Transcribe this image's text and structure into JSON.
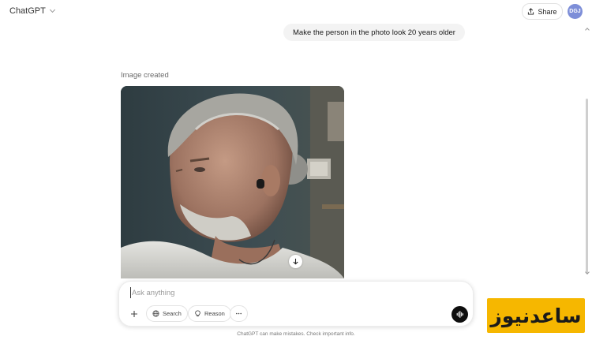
{
  "header": {
    "model_name": "ChatGPT",
    "share_label": "Share",
    "avatar_initials": "DGJ",
    "avatar_color": "#7d8ed8"
  },
  "conversation": {
    "user_message": "Make the person in the photo look 20 years older",
    "image_caption": "Image created"
  },
  "composer": {
    "placeholder": "Ask anything",
    "tools": [
      {
        "label": "Search",
        "icon": "globe-icon"
      },
      {
        "label": "Reason",
        "icon": "lightbulb-icon"
      }
    ],
    "more_icon": "ellipsis-icon",
    "add_icon": "plus-icon",
    "voice_icon": "voice-mode-icon"
  },
  "footer": {
    "disclaimer": "ChatGPT can make mistakes. Check important info."
  },
  "watermark": {
    "text": "ساعدنیوز",
    "color": "#f6b700"
  }
}
